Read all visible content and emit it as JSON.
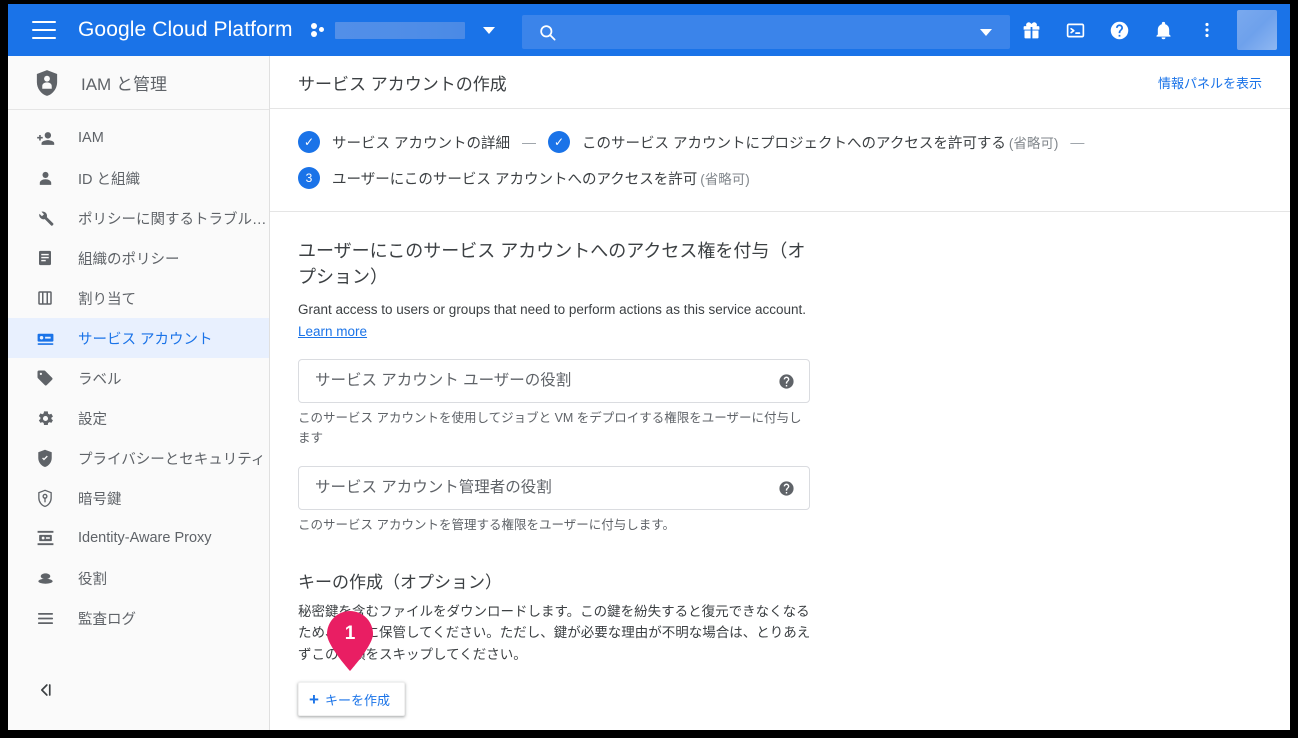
{
  "topbar": {
    "menu_icon": "hamburger-menu-icon",
    "brand": "Google Cloud Platform",
    "project_selector": {
      "icon": "project-dots-icon",
      "value": "",
      "redacted": true,
      "caret": "chevron-down-icon"
    },
    "search": {
      "icon": "search-icon",
      "value": "",
      "placeholder": "",
      "caret": "chevron-down-icon"
    },
    "icons": [
      {
        "name": "gift-icon",
        "glyph": "gift"
      },
      {
        "name": "cloud-shell-icon",
        "glyph": "terminal"
      },
      {
        "name": "help-icon",
        "glyph": "question"
      },
      {
        "name": "notifications-bell-icon",
        "glyph": "bell"
      },
      {
        "name": "more-options-icon",
        "glyph": "vertical-dots"
      }
    ],
    "avatar": {
      "name": "user-avatar",
      "label": ""
    },
    "accent_color": "#1a73e8"
  },
  "sidebar": {
    "header": {
      "icon": "iam-shield-person-icon",
      "title": "IAM と管理"
    },
    "items": [
      {
        "label": "IAM",
        "icon": "person-add-icon",
        "active": false
      },
      {
        "label": "ID と組織",
        "icon": "person-circle-icon",
        "active": false
      },
      {
        "label": "ポリシーに関するトラブル…",
        "icon": "wrench-icon",
        "active": false
      },
      {
        "label": "組織のポリシー",
        "icon": "document-icon",
        "active": false
      },
      {
        "label": "割り当て",
        "icon": "quota-icon",
        "active": false
      },
      {
        "label": "サービス アカウント",
        "icon": "service-account-key-icon",
        "active": true
      },
      {
        "label": "ラベル",
        "icon": "tag-icon",
        "active": false
      },
      {
        "label": "設定",
        "icon": "gear-icon",
        "active": false
      },
      {
        "label": "プライバシーとセキュリティ",
        "icon": "shield-check-icon",
        "active": false
      },
      {
        "label": "暗号鍵",
        "icon": "encryption-key-shield-icon",
        "active": false
      },
      {
        "label": "Identity-Aware Proxy",
        "icon": "iap-icon",
        "active": false
      },
      {
        "label": "役割",
        "icon": "roles-icon",
        "active": false
      },
      {
        "label": "監査ログ",
        "icon": "audit-logs-icon",
        "active": false
      }
    ],
    "collapse": {
      "name": "collapse-sidebar-icon",
      "label": ""
    }
  },
  "page": {
    "title": "サービス アカウントの作成",
    "info_panel_link": "情報パネルを表示"
  },
  "stepper": {
    "steps": [
      {
        "badge": "✓",
        "state": "complete",
        "label": "サービス アカウントの詳細",
        "optional": ""
      },
      {
        "badge": "✓",
        "state": "complete",
        "label": "このサービス アカウントにプロジェクトへのアクセスを許可する",
        "optional": "(省略可)"
      },
      {
        "badge": "3",
        "state": "current",
        "label": "ユーザーにこのサービス アカウントへのアクセスを許可",
        "optional": "(省略可)"
      }
    ],
    "separator": "—"
  },
  "grant_section": {
    "title": "ユーザーにこのサービス アカウントへのアクセス権を付与（オプション）",
    "description": "Grant access to users or groups that need to perform actions as this service account.",
    "learn_more": "Learn more",
    "fields": [
      {
        "placeholder": "サービス アカウント ユーザーの役割",
        "value": "",
        "help_icon": "help-circle-icon",
        "hint": "このサービス アカウントを使用してジョブと VM をデプロイする権限をユーザーに付与します"
      },
      {
        "placeholder": "サービス アカウント管理者の役割",
        "value": "",
        "help_icon": "help-circle-icon",
        "hint": "このサービス アカウントを管理する権限をユーザーに付与します。"
      }
    ]
  },
  "keys_section": {
    "title": "キーの作成（オプション）",
    "description": "秘密鍵を含むファイルをダウンロードします。この鍵を紛失すると復元できなくなるため、大切に保管してください。ただし、鍵が必要な理由が不明な場合は、とりあえずこの手順をスキップしてください。",
    "create_button": {
      "plus": "+",
      "label": "キーを作成"
    }
  },
  "annotation": {
    "pin": {
      "number": "1",
      "color": "#e91e63"
    }
  }
}
